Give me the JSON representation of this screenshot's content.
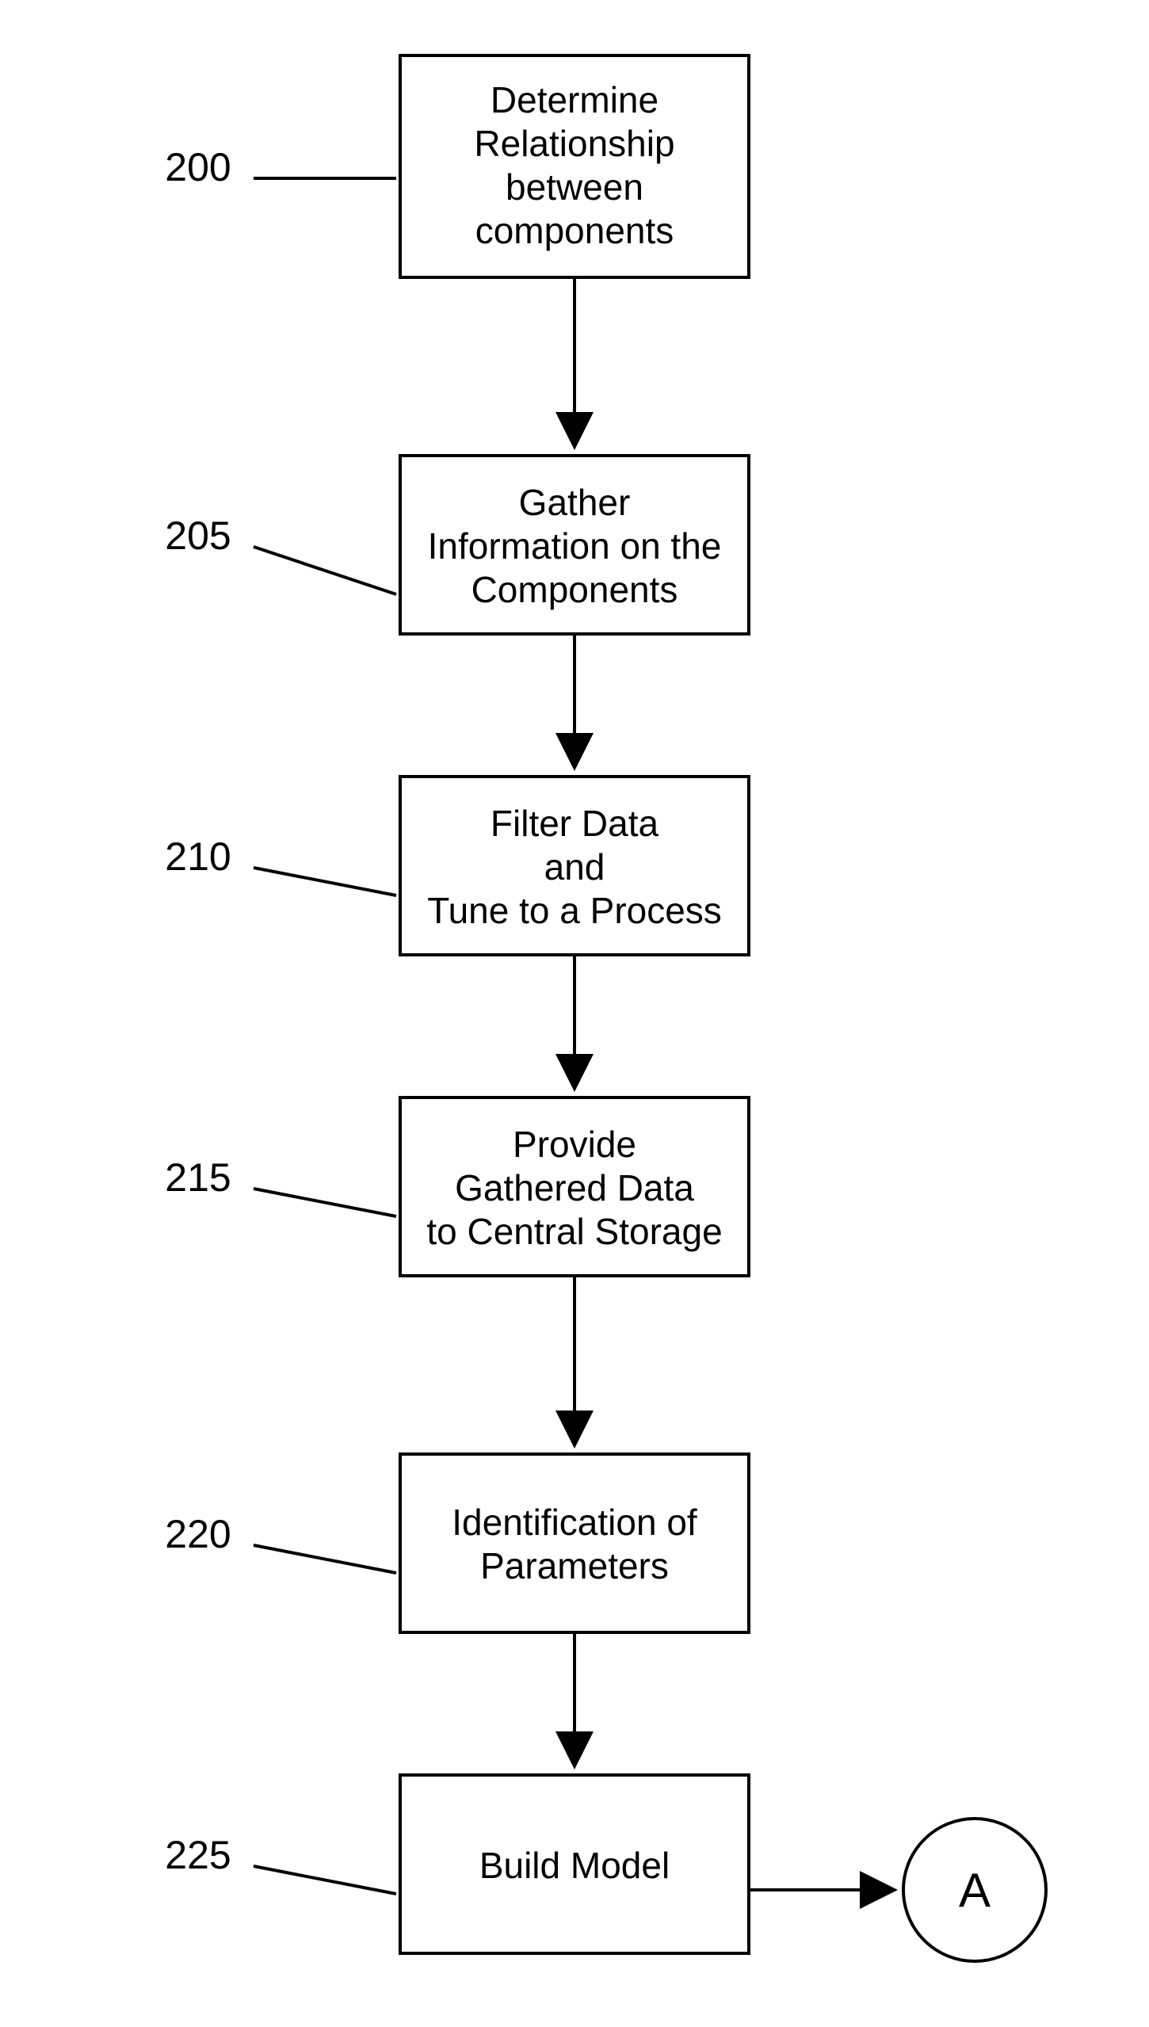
{
  "flowchart": {
    "boxes": [
      {
        "ref": "200",
        "lines": [
          "Determine",
          "Relationship",
          "between",
          "components"
        ]
      },
      {
        "ref": "205",
        "lines": [
          "Gather",
          "Information on the",
          "Components"
        ]
      },
      {
        "ref": "210",
        "lines": [
          "Filter Data",
          "and",
          "Tune to a Process"
        ]
      },
      {
        "ref": "215",
        "lines": [
          "Provide",
          "Gathered Data",
          "to Central Storage"
        ]
      },
      {
        "ref": "220",
        "lines": [
          "Identification of",
          "Parameters"
        ]
      },
      {
        "ref": "225",
        "lines": [
          "Build Model"
        ]
      }
    ],
    "connector": {
      "label": "A"
    }
  }
}
